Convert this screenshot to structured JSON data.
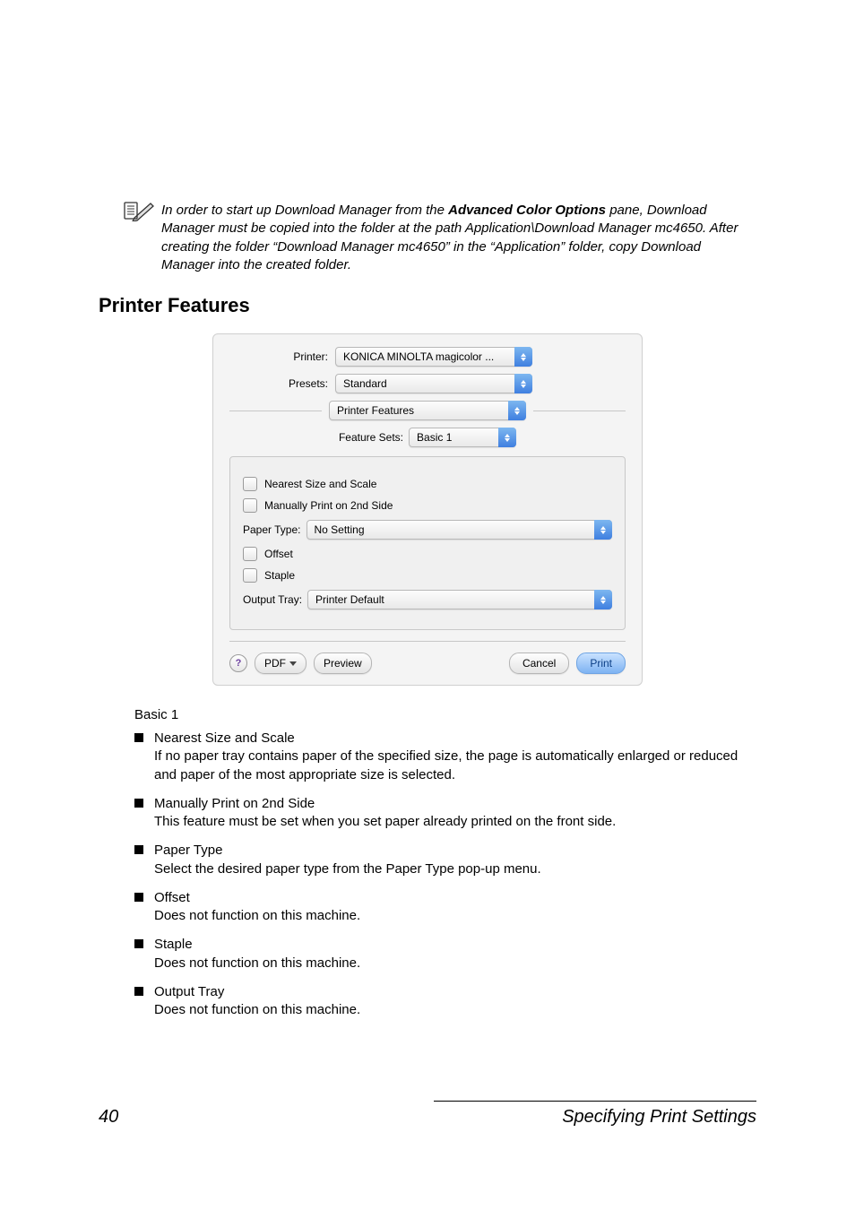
{
  "note": {
    "pre": "In order to start up Download Manager from the ",
    "bold": "Advanced Color Options",
    "post": " pane, Download Manager must be copied into the folder at the path Application\\Download Manager mc4650. After creating the folder “Download Manager mc4650” in the “Application” folder, copy Download Manager into the created folder."
  },
  "section_title": "Printer Features",
  "dialog": {
    "rows": {
      "printer_label": "Printer:",
      "printer_value": "KONICA MINOLTA magicolor ...",
      "presets_label": "Presets:",
      "presets_value": "Standard",
      "pane_value": "Printer Features",
      "feature_sets_label": "Feature Sets:",
      "feature_sets_value": "Basic 1"
    },
    "checks": {
      "nearest": "Nearest Size and Scale",
      "manual2nd": "Manually Print on 2nd Side",
      "offset": "Offset",
      "staple": "Staple"
    },
    "fields": {
      "paper_type_label": "Paper Type:",
      "paper_type_value": "No Setting",
      "output_tray_label": "Output Tray:",
      "output_tray_value": "Printer Default"
    },
    "buttons": {
      "help": "?",
      "pdf": "PDF",
      "preview": "Preview",
      "cancel": "Cancel",
      "print": "Print"
    }
  },
  "lower": {
    "subhead": "Basic 1",
    "items": [
      {
        "t1": "Nearest Size and Scale",
        "t2": "If no paper tray contains paper of the specified size, the page is automatically enlarged or reduced and paper of the most appropriate size is selected."
      },
      {
        "t1": "Manually Print on 2nd Side",
        "t2": "This feature must be set when you set paper already printed on the front side."
      },
      {
        "t1": "Paper Type",
        "t2": "Select the desired paper type from the Paper Type pop-up menu."
      },
      {
        "t1": "Offset",
        "t2": "Does not function on this machine."
      },
      {
        "t1": "Staple",
        "t2": "Does not function on this machine."
      },
      {
        "t1": "Output Tray",
        "t2": "Does not function on this machine."
      }
    ]
  },
  "footer": {
    "page": "40",
    "title": "Specifying Print Settings"
  }
}
